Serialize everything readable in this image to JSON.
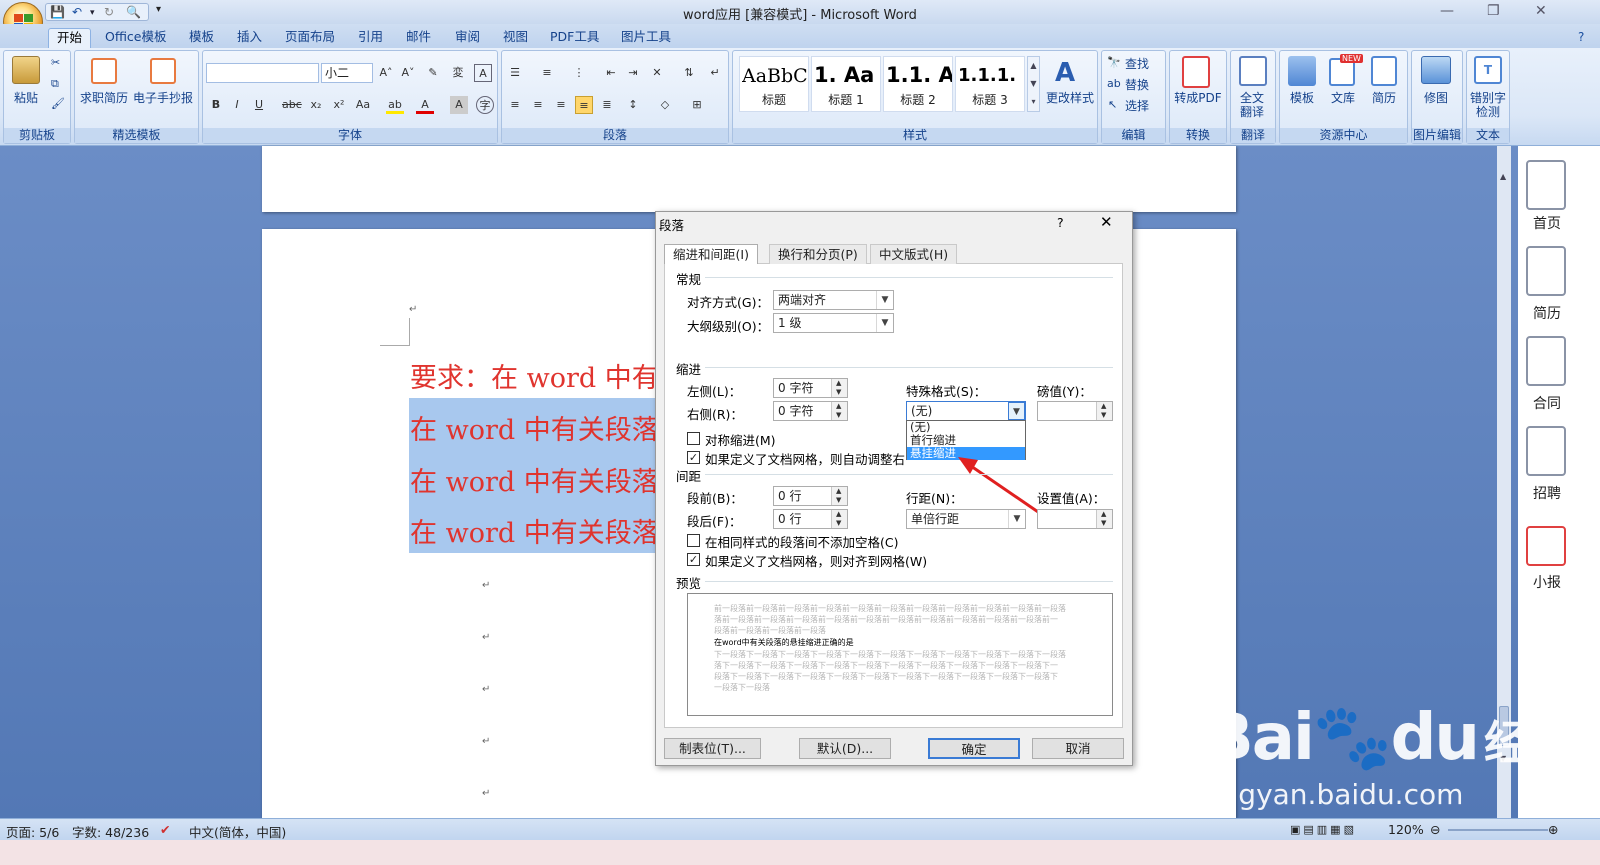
{
  "window": {
    "title": "word应用 [兼容模式] - Microsoft Word"
  },
  "qat": {
    "save_icon": "save-icon",
    "undo_icon": "undo-icon",
    "redo_icon": "redo-icon",
    "preview_icon": "print-preview-icon"
  },
  "tabs": [
    "开始",
    "Office模板",
    "模板",
    "插入",
    "页面布局",
    "引用",
    "邮件",
    "审阅",
    "视图",
    "PDF工具",
    "图片工具"
  ],
  "ribbon": {
    "clipboard": {
      "paste": "粘贴",
      "label": "剪贴板"
    },
    "templates": {
      "resume": "求职简历",
      "tabloid": "电子手抄报",
      "label": "精选模板"
    },
    "font": {
      "name_value": "",
      "size_value": "小二",
      "label": "字体"
    },
    "paragraph": {
      "label": "段落"
    },
    "styles": {
      "items": [
        {
          "preview": "AaBbC",
          "name": "标题"
        },
        {
          "preview": "1.  Aa",
          "name": "标题 1"
        },
        {
          "preview": "1.1.  A",
          "name": "标题 2"
        },
        {
          "preview": "1.1.1.",
          "name": "标题 3"
        }
      ],
      "change": "更改样式",
      "label": "样式"
    },
    "editing": {
      "find": "查找",
      "replace": "替换",
      "select": "选择",
      "label": "编辑"
    },
    "convert": {
      "topdf": "转成PDF",
      "label": "转换"
    },
    "translate": {
      "full": "全文翻译",
      "label": "翻译"
    },
    "resources": {
      "template": "模板",
      "library": "文库",
      "resume": "简历",
      "label": "资源中心",
      "badge": "NEW"
    },
    "image": {
      "retouch": "修图",
      "label": "图片编辑"
    },
    "text": {
      "typo": "错别字检测",
      "label": "文本"
    }
  },
  "document": {
    "heading": "要求：在 word 中有",
    "lines": [
      "在 word 中有关段落",
      "在 word 中有关段落",
      "在 word 中有关段落"
    ]
  },
  "dialog": {
    "title": "段落",
    "help": "?",
    "tabs": [
      "缩进和间距(I)",
      "换行和分页(P)",
      "中文版式(H)"
    ],
    "general": {
      "section": "常规",
      "align_label": "对齐方式(G)：",
      "align_value": "两端对齐",
      "outline_label": "大纲级别(O)：",
      "outline_value": "1 级"
    },
    "indent": {
      "section": "缩进",
      "left_label": "左侧(L)：",
      "left_value": "0 字符",
      "right_label": "右侧(R)：",
      "right_value": "0 字符",
      "special_label": "特殊格式(S)：",
      "special_value": "(无)",
      "by_label": "磅值(Y)：",
      "by_value": "",
      "mirror_label": "对称缩进(M)",
      "grid_label": "如果定义了文档网格，则自动调整右缩进(D)",
      "options": [
        "(无)",
        "首行缩进",
        "悬挂缩进"
      ],
      "highlighted_option": "悬挂缩进"
    },
    "spacing": {
      "section": "间距",
      "before_label": "段前(B)：",
      "before_value": "0 行",
      "after_label": "段后(F)：",
      "after_value": "0 行",
      "line_label": "行距(N)：",
      "line_value": "单倍行距",
      "at_label": "设置值(A)：",
      "at_value": "",
      "nospace_label": "在相同样式的段落间不添加空格(C)",
      "snap_label": "如果定义了文档网格，则对齐到网格(W)"
    },
    "preview": {
      "section": "预览",
      "prev_lines": [
        "前一段落前一段落前一段落前一段落前一段落前一段落前一段落前一段落前一段落前一段落前一段落",
        "落前一段落前一段落前一段落前一段落前一段落前一段落前一段落前一段落前一段落前一段落前一",
        "段落前一段落前一段落前一段落"
      ],
      "sample": "在word中有关段落的悬挂缩进正确的是",
      "next_lines": [
        "下一段落下一段落下一段落下一段落下一段落下一段落下一段落下一段落下一段落下一段落下一段落",
        "落下一段落下一段落下一段落下一段落下一段落下一段落下一段落下一段落下一段落下一段落下一",
        "段落下一段落下一段落下一段落下一段落下一段落下一段落下一段落下一段落下一段落下一段落下",
        "一段落下一段落"
      ]
    },
    "buttons": {
      "tabs": "制表位(T)...",
      "default": "默认(D)...",
      "ok": "确定",
      "cancel": "取消"
    }
  },
  "side_panel": {
    "items": [
      "首页",
      "简历",
      "合同",
      "招聘",
      "小报"
    ]
  },
  "status": {
    "page": "页面: 5/6",
    "words": "字数: 48/236",
    "lang": "中文(简体，中国)",
    "zoom": "120%"
  },
  "watermark": {
    "brand": "Bai",
    "suffix": "du",
    "cn": "经验",
    "url": "jingyan.baidu.com"
  },
  "colors": {
    "accent_red": "#e0342e",
    "selection": "#a8c8ee",
    "ribbon_text": "#15428b",
    "highlight_blue": "#3399ff"
  }
}
